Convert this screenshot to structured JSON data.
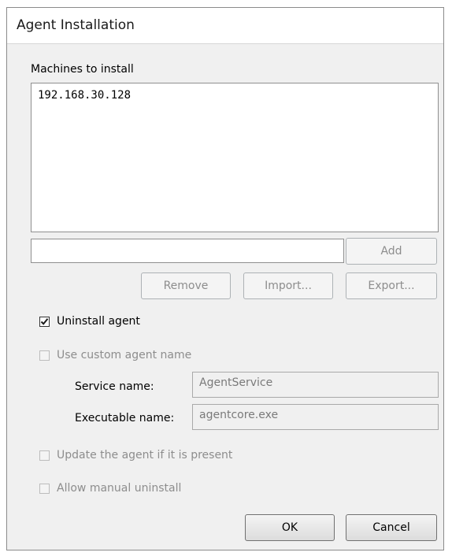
{
  "window": {
    "title": "Agent Installation"
  },
  "machines": {
    "label": "Machines to install",
    "items": [
      "192.168.30.128"
    ],
    "new_entry_value": ""
  },
  "buttons": {
    "add": "Add",
    "remove": "Remove",
    "import": "Import...",
    "export": "Export...",
    "ok": "OK",
    "cancel": "Cancel"
  },
  "options": {
    "uninstall_agent": {
      "label": "Uninstall agent",
      "checked": true,
      "enabled": true
    },
    "use_custom_agent_name": {
      "label": "Use custom agent name",
      "checked": false,
      "enabled": false
    },
    "update_agent": {
      "label": "Update the agent if it is present",
      "checked": false,
      "enabled": false
    },
    "allow_manual_uninstall": {
      "label": "Allow manual uninstall",
      "checked": false,
      "enabled": false
    }
  },
  "custom_name": {
    "service_label": "Service name:",
    "service_value": "AgentService",
    "executable_label": "Executable name:",
    "executable_value": "agentcore.exe"
  }
}
